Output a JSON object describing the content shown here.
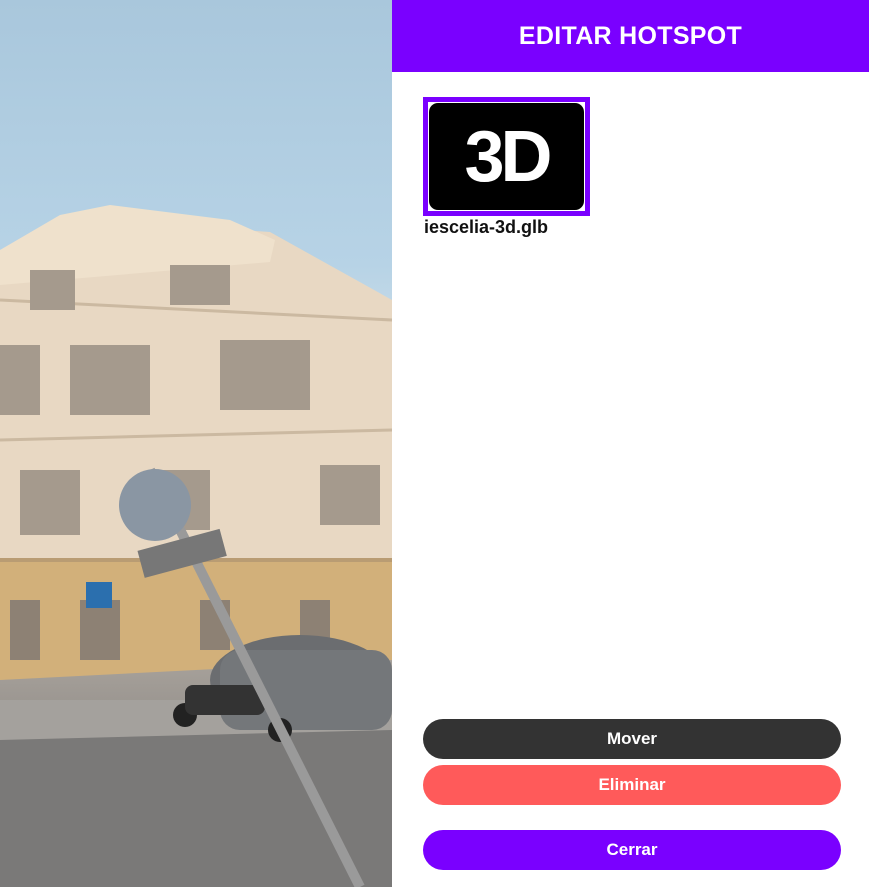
{
  "panel": {
    "title": "EDITAR HOTSPOT",
    "asset": {
      "thumbnail_text": "3D",
      "filename": "iescelia-3d.glb"
    },
    "buttons": {
      "move": "Mover",
      "delete": "Eliminar",
      "close": "Cerrar"
    }
  },
  "colors": {
    "accent": "#7a00ff",
    "move": "#333333",
    "delete": "#ff5a5a"
  }
}
